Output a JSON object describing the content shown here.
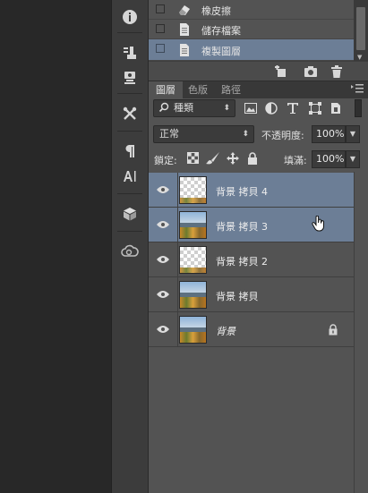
{
  "toolstrip": {
    "items": [
      {
        "name": "info-icon"
      },
      {
        "name": "brush-presets-icon"
      },
      {
        "name": "clone-source-icon"
      },
      {
        "name": "tool-presets-icon"
      },
      {
        "name": "paragraph-icon"
      },
      {
        "name": "character-styles-icon"
      },
      {
        "name": "3d-icon"
      },
      {
        "name": "creative-cloud-icon"
      }
    ]
  },
  "history": {
    "items": [
      {
        "label": "橡皮擦",
        "icon": "eraser-icon",
        "selected": false
      },
      {
        "label": "儲存檔案",
        "icon": "document-icon",
        "selected": false
      },
      {
        "label": "複製圖層",
        "icon": "document-icon",
        "selected": true
      }
    ]
  },
  "history_footer": {
    "icons": [
      "new-document-from-state-icon",
      "snapshot-camera-icon",
      "trash-icon"
    ]
  },
  "tabs": [
    {
      "label": "圖層",
      "active": true
    },
    {
      "label": "色版",
      "active": false
    },
    {
      "label": "路徑",
      "active": false
    }
  ],
  "filter": {
    "kind_label": "種類",
    "icons": [
      "image-filter-icon",
      "adjustment-filter-icon",
      "type-filter-icon",
      "shape-filter-icon",
      "smart-object-filter-icon"
    ]
  },
  "blend": {
    "mode": "正常",
    "opacity_label": "不透明度:",
    "opacity_value": "100%"
  },
  "lock": {
    "label": "鎖定:",
    "icons": [
      "lock-transparent-icon",
      "lock-image-icon",
      "lock-position-icon",
      "lock-all-icon"
    ],
    "fill_label": "填滿:",
    "fill_value": "100%"
  },
  "layers": [
    {
      "name": "背景 拷貝 4",
      "thumb": "transparent",
      "selected": true,
      "italic": false,
      "locked": false
    },
    {
      "name": "背景 拷貝 3",
      "thumb": "photo",
      "selected": true,
      "italic": false,
      "locked": false
    },
    {
      "name": "背景 拷貝 2",
      "thumb": "transparent",
      "selected": false,
      "italic": false,
      "locked": false
    },
    {
      "name": "背景 拷貝",
      "thumb": "photo",
      "selected": false,
      "italic": false,
      "locked": false
    },
    {
      "name": "背景",
      "thumb": "photo",
      "selected": false,
      "italic": true,
      "locked": true
    }
  ],
  "colors": {
    "panel": "#535353",
    "selection": "#6c7e96",
    "toolstrip": "#3c3c3c",
    "canvas": "#282828"
  }
}
